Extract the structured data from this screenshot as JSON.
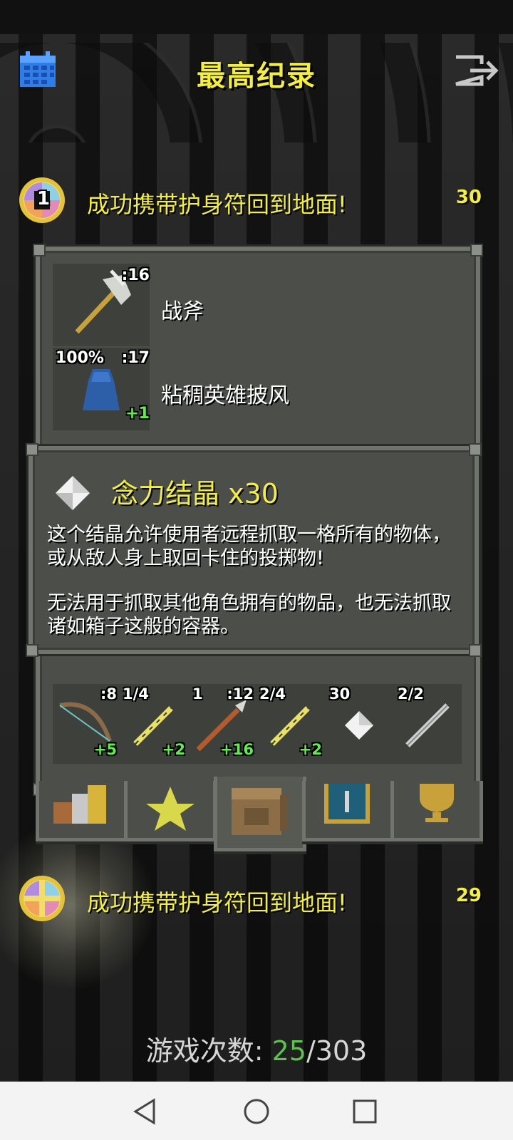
{
  "header": {
    "title": "最高纪录"
  },
  "records": [
    {
      "medal_number": "1",
      "text": "成功携带护身符回到地面!",
      "score": "30"
    },
    {
      "text": "成功携带护身符回到地面!",
      "score": "29"
    }
  ],
  "inventory": {
    "weapon": {
      "name": "战斧",
      "level": ":16",
      "icon": "battle-axe-icon"
    },
    "armor": {
      "name": "粘稠英雄披风",
      "durability": "100%",
      "level": ":17",
      "bonus": "+1",
      "icon": "cloak-icon"
    },
    "quickslots": [
      {
        "icon": "bow-icon",
        "top_right": ":8",
        "bonus": "+5"
      },
      {
        "icon": "wand-icon",
        "top_left": "1/4",
        "bonus": "+2"
      },
      {
        "icon": "spear-icon",
        "top_left": "1",
        "top_right": ":12",
        "bonus": "+16"
      },
      {
        "icon": "wand-icon",
        "top_left": "2/4",
        "bonus": "+2"
      },
      {
        "icon": "crystal-icon",
        "top_left": "30"
      },
      {
        "icon": "wand-icon",
        "top_left": "2/2"
      }
    ]
  },
  "tabs": [
    {
      "icon": "stats-icon"
    },
    {
      "icon": "star-icon"
    },
    {
      "icon": "backpack-icon"
    },
    {
      "icon": "spellbook-icon"
    },
    {
      "icon": "trophy-icon"
    }
  ],
  "tooltip": {
    "title": "念力结晶 x30",
    "desc1": "这个结晶允许使用者远程抓取一格所有的物体，或从敌人身上取回卡住的投掷物!",
    "desc2": "无法用于抓取其他角色拥有的物品，也无法抓取诸如箱子这般的容器。"
  },
  "games": {
    "label": "游戏次数:",
    "current": "25",
    "total": "/303"
  },
  "colors": {
    "title_yellow": "#f4ef3e",
    "bonus_green": "#5ef04a",
    "count_green": "#5ec24e",
    "panel": "#4b4e49"
  }
}
